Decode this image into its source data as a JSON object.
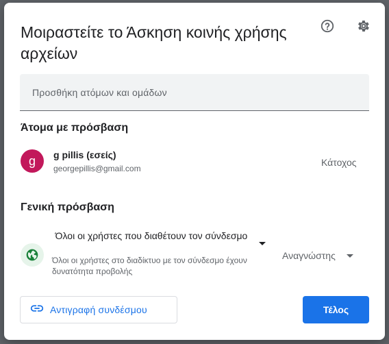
{
  "dialog": {
    "title": "Μοιραστείτε το Άσκηση κοινής χρήσης αρχείων",
    "help_icon": "help-icon",
    "settings_icon": "gear-icon"
  },
  "add_people": {
    "placeholder": "Προσθήκη ατόμων και ομάδων",
    "value": ""
  },
  "people_section": {
    "title": "Άτομα με πρόσβαση",
    "people": [
      {
        "avatar_letter": "g",
        "avatar_color": "#c2185b",
        "name": "g pillis (εσείς)",
        "email": "georgepillis@gmail.com",
        "role": "Κάτοχος"
      }
    ]
  },
  "general_access": {
    "title": "Γενική πρόσβαση",
    "icon": "globe-icon",
    "selected_option": "Όλοι οι χρήστες που διαθέτουν τον σύνδεσμο",
    "description": "Όλοι οι χρήστες στο διαδίκτυο με τον σύνδεσμο έχουν δυνατότητα προβολής",
    "role": "Αναγνώστης"
  },
  "footer": {
    "copy_link_label": "Αντιγραφή συνδέσμου",
    "copy_link_icon": "link-icon",
    "done_label": "Τέλος"
  },
  "colors": {
    "accent": "#1a73e8",
    "globe_bg": "#e6f4ea",
    "globe_fg": "#188038"
  }
}
